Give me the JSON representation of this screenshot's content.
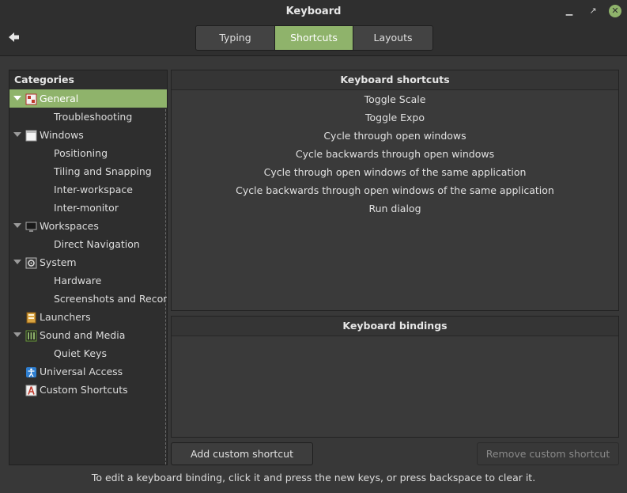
{
  "window": {
    "title": "Keyboard",
    "minimize_glyph": "▁",
    "maximize_glyph": "↗",
    "close_glyph": "✕"
  },
  "tabs": [
    {
      "label": "Typing",
      "active": false
    },
    {
      "label": "Shortcuts",
      "active": true
    },
    {
      "label": "Layouts",
      "active": false
    }
  ],
  "sidebar": {
    "header": "Categories",
    "items": [
      {
        "label": "General",
        "icon": "general-icon",
        "expanded": true,
        "active": true
      },
      {
        "label": "Troubleshooting"
      },
      {
        "label": "Windows",
        "icon": "windows-icon",
        "expanded": true
      },
      {
        "label": "Positioning"
      },
      {
        "label": "Tiling and Snapping"
      },
      {
        "label": "Inter-workspace"
      },
      {
        "label": "Inter-monitor"
      },
      {
        "label": "Workspaces",
        "icon": "workspaces-icon",
        "expanded": true
      },
      {
        "label": "Direct Navigation"
      },
      {
        "label": "System",
        "icon": "system-icon",
        "expanded": true
      },
      {
        "label": "Hardware"
      },
      {
        "label": "Screenshots and Recording"
      },
      {
        "label": "Launchers",
        "icon": "launchers-icon"
      },
      {
        "label": "Sound and Media",
        "icon": "sound-media-icon",
        "expanded": true
      },
      {
        "label": "Quiet Keys"
      },
      {
        "label": "Universal Access",
        "icon": "universal-access-icon"
      },
      {
        "label": "Custom Shortcuts",
        "icon": "custom-shortcuts-icon"
      }
    ]
  },
  "shortcuts": {
    "header": "Keyboard shortcuts",
    "items": [
      "Toggle Scale",
      "Toggle Expo",
      "Cycle through open windows",
      "Cycle backwards through open windows",
      "Cycle through open windows of the same application",
      "Cycle backwards through open windows of the same application",
      "Run dialog"
    ]
  },
  "bindings": {
    "header": "Keyboard bindings"
  },
  "buttons": {
    "add": "Add custom shortcut",
    "remove": "Remove custom shortcut"
  },
  "hint": "To edit a keyboard binding, click it and press the new keys, or press backspace to clear it.",
  "colors": {
    "accent": "#8fb36b",
    "background": "#383838",
    "sidebar": "#2e2e2e"
  }
}
